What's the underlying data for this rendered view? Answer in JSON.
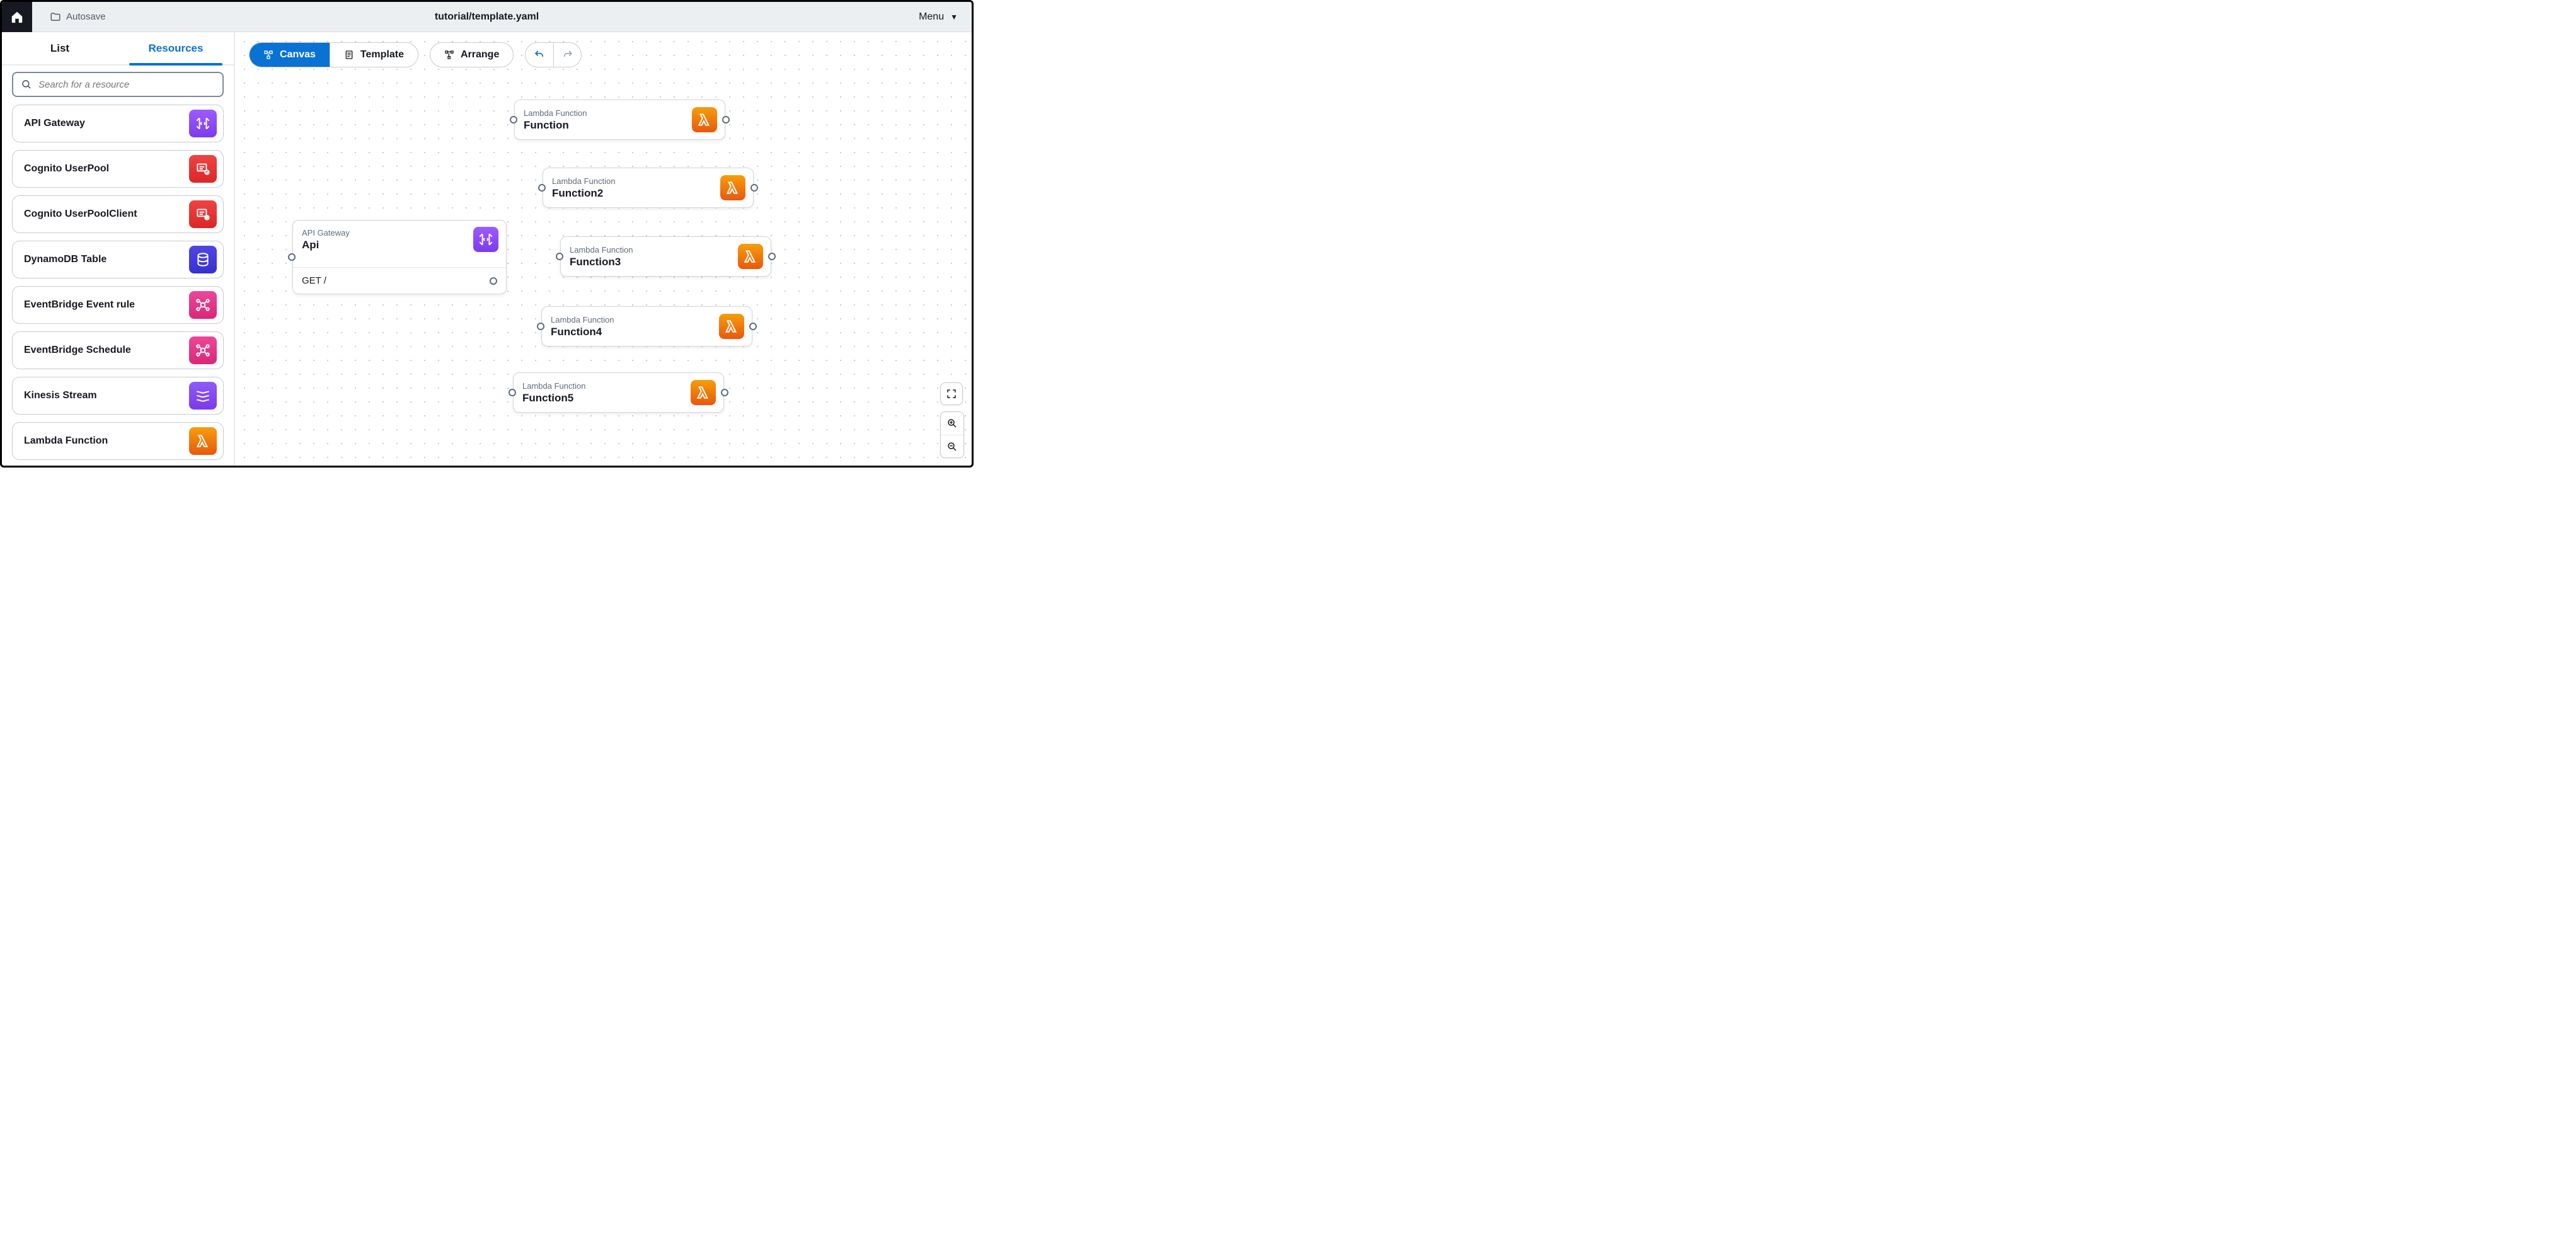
{
  "header": {
    "autosave_label": "Autosave",
    "title": "tutorial/template.yaml",
    "menu_label": "Menu"
  },
  "sidebar": {
    "tabs": {
      "list": "List",
      "resources": "Resources"
    },
    "search_placeholder": "Search for a resource",
    "items": [
      {
        "label": "API Gateway",
        "icon": "api-gateway-icon",
        "color": "ic-purple"
      },
      {
        "label": "Cognito UserPool",
        "icon": "cognito-icon",
        "color": "ic-red"
      },
      {
        "label": "Cognito UserPoolClient",
        "icon": "cognito-client-icon",
        "color": "ic-red"
      },
      {
        "label": "DynamoDB Table",
        "icon": "dynamodb-icon",
        "color": "ic-blue"
      },
      {
        "label": "EventBridge Event rule",
        "icon": "eventbridge-icon",
        "color": "ic-pink"
      },
      {
        "label": "EventBridge Schedule",
        "icon": "eventbridge-schedule-icon",
        "color": "ic-pink"
      },
      {
        "label": "Kinesis Stream",
        "icon": "kinesis-icon",
        "color": "ic-violet"
      },
      {
        "label": "Lambda Function",
        "icon": "lambda-icon",
        "color": "ic-orange"
      }
    ]
  },
  "toolbar": {
    "canvas_label": "Canvas",
    "template_label": "Template",
    "arrange_label": "Arrange"
  },
  "nodes": {
    "api": {
      "type": "API Gateway",
      "name": "Api",
      "route": "GET /"
    },
    "fn1": {
      "type": "Lambda Function",
      "name": "Function"
    },
    "fn2": {
      "type": "Lambda Function",
      "name": "Function2"
    },
    "fn3": {
      "type": "Lambda Function",
      "name": "Function3"
    },
    "fn4": {
      "type": "Lambda Function",
      "name": "Function4"
    },
    "fn5": {
      "type": "Lambda Function",
      "name": "Function5"
    }
  }
}
